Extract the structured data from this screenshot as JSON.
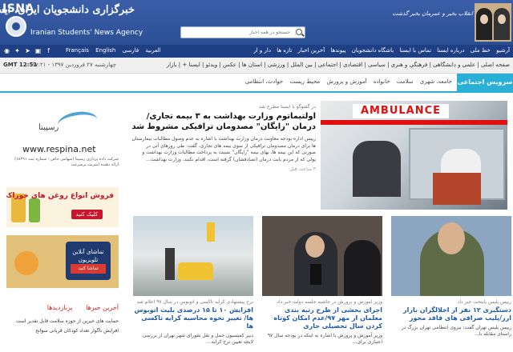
{
  "header": {
    "logo_text": "ISNA",
    "agency_fa": "خبرگزاری دانشجویان ایران، ایسنا",
    "agency_en": "Iranian Students' News Agency",
    "quote": "انقلاب بخیر و عمرمان بخیر گذشت",
    "search_placeholder": "جستجو در همه اخبار"
  },
  "topnav": {
    "links": [
      "آرشیو",
      "خط ملی",
      "درباره ایسنا",
      "تماس با ایسنا",
      "باشگاه دانشجویان",
      "پیوندها",
      "آخرین اخبار",
      "تازه ها",
      "دار و ار"
    ],
    "languages": [
      "فارسی",
      "العربية",
      "English",
      "Français"
    ]
  },
  "secnav": {
    "clock": "GMT 12:51",
    "date": "چهارشنبه ۲۷ فروردین ۱۳۹۷ - ۱۷:۲۱",
    "items": "صفحه اصلی | علمی و دانشگاهی | فرهنگی و هنری | سیاسی | اقتصادی | اجتماعی | بین الملل | ورزشی | استان ها | عکس | ویدئو | ایسنا + | بازار"
  },
  "servicebar": {
    "title": "سرویس اجتماعی",
    "tabs": [
      "جامعه، شهری",
      "سلامت",
      "خانواده",
      "آموزش و پرورش",
      "محیط زیست",
      "حوادث، انتظامی"
    ]
  },
  "ads": {
    "respina_word": "رسپینا",
    "respina_url": "www.respina.net",
    "respina_text": "شرکت داده پردازی رسپینا (سهامی خاص - شماره ثبت ۱۸۲۹۱) ارائه دهنده اینترنت پرسرعت",
    "oil_title": "فروش انواع روغن های خوراکی",
    "oil_button": "کلیک کنید",
    "tv_title": "تماشای آنلاین تلویزیون",
    "tv_button": "تماشا کنید"
  },
  "featured": {
    "category": "در گفتوگو با ایسنا مطرح شد",
    "title": "اولتیماتوم وزارت بهداشت به ۳ بیمه تجاری/درمان \"رایگان\" مصدومان ترافیکی مشروط شد",
    "body": "رییس اداره بودجه معاونت درمان وزارت بهداشت با اشاره به عدم وصول مطالبات بیمارستان ها برای درمان مصدومان ترافیکی از سوی بیمه های تجاری، گفت: طی روزهای آتی در صورتی که این بیمه ها، بهای بیمه \"رایگان\" نسبت به پرداخت مطالبات وزارت بهداشت و پولی که از مردم بابت درمان (تصادفشان) گرفته است، اقدام نکنند، وزارت بهداشت...",
    "time": "۳ ساعت قبل",
    "image_sign": "AMBULANCE"
  },
  "cards": [
    {
      "category": "نرخ پیشنهادی کرایه تاکسی و اتوبوس در سال ۹۷ اعلام شد",
      "title": "افزایش ۱۰ تا ۱۵ درصدی بلیت اتوبوس ها/ تغییر نحوه محاسبه کرایه تاکسی ها",
      "summary": "دبیر کمیسیون حمل و نقل شورای شهر تهران از بررسی لایحه تعیین نرخ کرایه..."
    },
    {
      "category": "وزیر آموزش و پرورش در حاشیه جلسه دولت خبر داد",
      "title": "اجرای بخشی از طرح رتبه بندی معلمان از مهر ۹۷/عدم امکان کوتاه کردن سال تحصیلی جاری",
      "summary": "وزیر آموزش و پرورش با اشاره به اینکه در بودجه سال ۹۷ اعتباری برای..."
    },
    {
      "category": "رییس پلیس پایتخت خبر داد",
      "title": "دستگیری ۱۲ نفر از اخلالگران بازار ارز/پلیب صرافی های فاقد مجوز",
      "summary": "رییس پلیس تهران گفت: نیروی انتظامی تهران بزرگ در راستای مقابله با..."
    }
  ],
  "lefttabs": {
    "tabs": [
      "آخرین خبرها",
      "پربازدیدها"
    ],
    "items": [
      "حمایت های خیرین از حوزه سلامت قابل تقدیر است",
      "افزایش ناگوار تعداد کودکان قربانی سوانح"
    ]
  },
  "colors": {
    "header_blue": "#2b4f95",
    "service_cyan": "#2ab0d6",
    "link_blue": "#1f5aa8",
    "accent_red": "#d22"
  }
}
